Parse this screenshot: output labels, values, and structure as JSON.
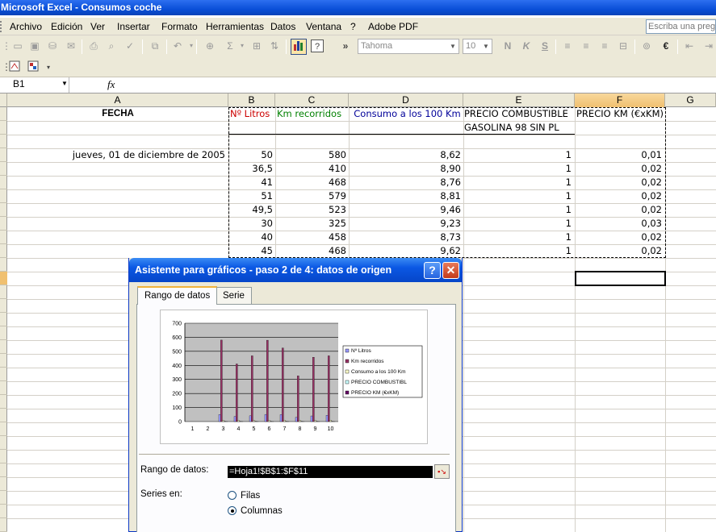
{
  "window": {
    "title": "Microsoft Excel - Consumos coche"
  },
  "menu": {
    "items": [
      "Archivo",
      "Edición",
      "Ver",
      "Insertar",
      "Formato",
      "Herramientas",
      "Datos",
      "Ventana",
      "?",
      "Adobe PDF"
    ],
    "help_placeholder": "Escriba una pregu"
  },
  "toolbar": {
    "font_name": "Tahoma",
    "font_size": "10",
    "bold": "N",
    "italic": "K",
    "underline": "S",
    "sigma": "Σ",
    "euro": "€",
    "more": "»"
  },
  "formula_bar": {
    "name_box": "B1",
    "fx_label": "fx",
    "content": ""
  },
  "sheet": {
    "columns": [
      "A",
      "B",
      "C",
      "D",
      "E",
      "F",
      "G"
    ],
    "header": {
      "a": "FECHA",
      "b": "Nº Litros",
      "c": "Km recorridos",
      "d": "Consumo a los 100 Km",
      "e": "PRECIO COMBUSTIBLE",
      "f": "PRECIO KM (€xKM)"
    },
    "e_subheader": "GASOLINA 98 SIN PL",
    "rows": [
      {
        "a": "jueves, 01 de diciembre de 2005",
        "b": "50",
        "c": "580",
        "d": "8,62",
        "e": "1",
        "f": "0,01"
      },
      {
        "a": "",
        "b": "36,5",
        "c": "410",
        "d": "8,90",
        "e": "1",
        "f": "0,02"
      },
      {
        "a": "",
        "b": "41",
        "c": "468",
        "d": "8,76",
        "e": "1",
        "f": "0,02"
      },
      {
        "a": "",
        "b": "51",
        "c": "579",
        "d": "8,81",
        "e": "1",
        "f": "0,02"
      },
      {
        "a": "",
        "b": "49,5",
        "c": "523",
        "d": "9,46",
        "e": "1",
        "f": "0,02"
      },
      {
        "a": "",
        "b": "30",
        "c": "325",
        "d": "9,23",
        "e": "1",
        "f": "0,03"
      },
      {
        "a": "",
        "b": "40",
        "c": "458",
        "d": "8,73",
        "e": "1",
        "f": "0,02"
      },
      {
        "a": "",
        "b": "45",
        "c": "468",
        "d": "9,62",
        "e": "1",
        "f": "0,02"
      }
    ]
  },
  "dialog": {
    "title": "Asistente para gráficos - paso 2 de 4: datos de origen",
    "help_button": "?",
    "close_button": "✕",
    "tabs": [
      "Rango de datos",
      "Serie"
    ],
    "range_label": "Rango de datos:",
    "range_value": "=Hoja1!$B$1:$F$11",
    "series_in_label": "Series en:",
    "option_rows": "Filas",
    "option_columns": "Columnas",
    "selected_option": "Columnas"
  },
  "chart_data": {
    "type": "bar",
    "categories": [
      "1",
      "2",
      "3",
      "4",
      "5",
      "6",
      "7",
      "8",
      "9",
      "10"
    ],
    "ylim": [
      0,
      700
    ],
    "yticks": [
      "0",
      "100",
      "200",
      "300",
      "400",
      "500",
      "600",
      "700"
    ],
    "grid": true,
    "legend_position": "right",
    "series": [
      {
        "name": "Nº Litros",
        "values": [
          0,
          0,
          50,
          36.5,
          41,
          51,
          49.5,
          30,
          40,
          45
        ],
        "color": "#9999ff"
      },
      {
        "name": "Km recorridos",
        "values": [
          0,
          0,
          580,
          410,
          468,
          579,
          523,
          325,
          458,
          468
        ],
        "color": "#993366"
      },
      {
        "name": "Consumo a los 100 Km",
        "values": [
          0,
          0,
          8.62,
          8.9,
          8.76,
          8.81,
          9.46,
          9.23,
          8.73,
          9.62
        ],
        "color": "#ffffcc"
      },
      {
        "name": "PRECIO COMBUSTIBL",
        "values": [
          0,
          0,
          1,
          1,
          1,
          1,
          1,
          1,
          1,
          1
        ],
        "color": "#ccffff"
      },
      {
        "name": "PRECIO KM (€xKM)",
        "values": [
          0,
          0,
          0.01,
          0.02,
          0.02,
          0.02,
          0.02,
          0.03,
          0.02,
          0.02
        ],
        "color": "#660066"
      }
    ]
  },
  "colors": {
    "title_bar": "#0a4fd8",
    "header_b": "#cc0000",
    "header_c": "#008000",
    "header_d": "#000099",
    "chart_plot_bg": "#c0c0c0"
  }
}
